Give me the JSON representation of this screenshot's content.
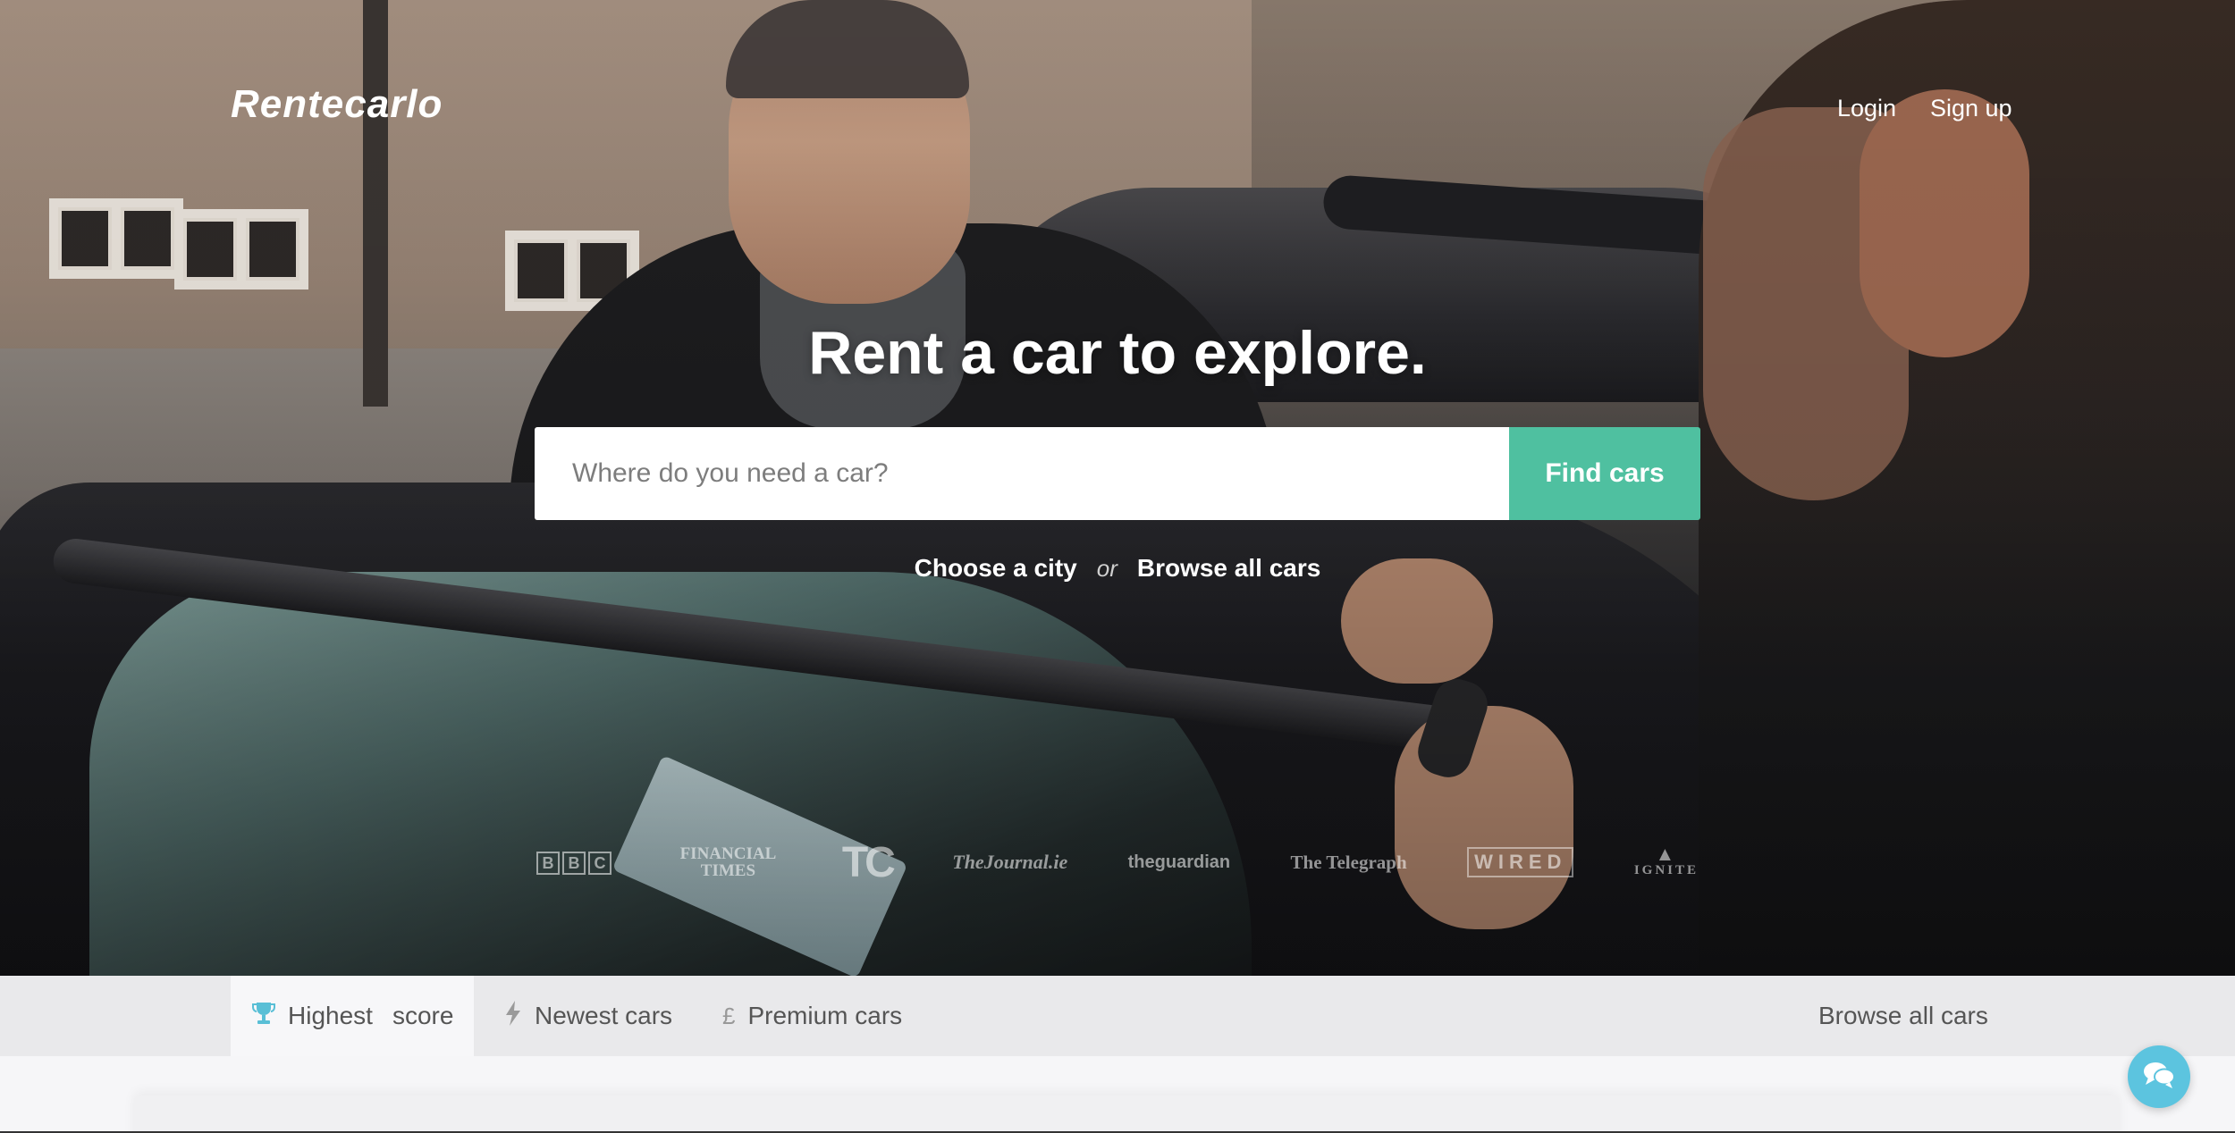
{
  "header": {
    "logo": "Rentecarlo",
    "login_label": "Login",
    "signup_label": "Sign up"
  },
  "hero": {
    "headline": "Rent a car to explore.",
    "search": {
      "placeholder": "Where do you need a car?",
      "value": "",
      "button_label": "Find cars"
    },
    "choose_city_label": "Choose a city",
    "or_label": "or",
    "browse_all_label": "Browse all cars",
    "press_logos": [
      "BBC",
      "FINANCIAL TIMES",
      "TC",
      "TheJournal.ie",
      "theguardian",
      "The Telegraph",
      "WIRED",
      "IGNITE"
    ]
  },
  "tabs": {
    "items": [
      {
        "label": "Highest",
        "label_extra": "score",
        "icon": "trophy-icon",
        "active": true
      },
      {
        "label": "Newest cars",
        "icon": "lightning-icon",
        "active": false
      },
      {
        "label": "Premium cars",
        "icon": "pound-icon",
        "active": false
      }
    ],
    "browse_all_label": "Browse all cars"
  },
  "chat": {
    "icon": "chat-icon"
  },
  "colors": {
    "accent": "#4fc0a0",
    "trophy": "#59bfd6",
    "chat": "#5cc4df",
    "tabbar": "#e9e9eb"
  }
}
